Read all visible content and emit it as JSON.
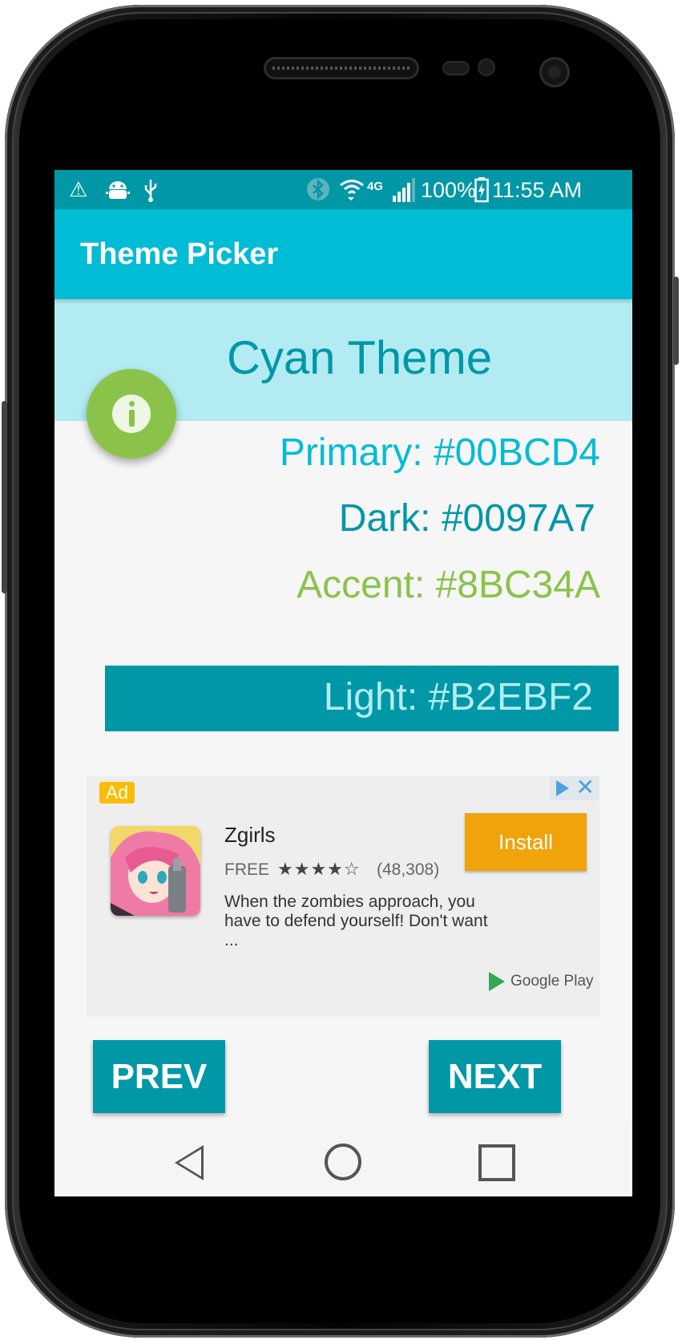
{
  "status_bar": {
    "icons": [
      "warning-icon",
      "android-debug-icon",
      "usb-icon",
      "bluetooth-icon",
      "wifi-icon",
      "signal-icon",
      "battery-charging-icon"
    ],
    "network": "4G",
    "battery": "100%",
    "time": "11:55 AM"
  },
  "app_bar": {
    "title": "Theme Picker"
  },
  "theme": {
    "title": "Cyan Theme",
    "primary": "Primary: #00BCD4",
    "dark": "Dark: #0097A7",
    "accent": "Accent: #8BC34A",
    "light": "Light: #B2EBF2",
    "colors": {
      "primary": "#00BCD4",
      "dark": "#0097A7",
      "accent": "#8BC34A",
      "light": "#B2EBF2"
    }
  },
  "fab": {
    "icon": "info-icon"
  },
  "ad": {
    "badge": "Ad",
    "app_name": "Zgirls",
    "price": "FREE",
    "stars": "★★★★☆",
    "rating": 4,
    "rating_count": "(48,308)",
    "description": "When the zombies approach, you have to defend yourself! Don't want ...",
    "install_label": "Install",
    "store_label": "Google Play"
  },
  "buttons": {
    "prev": "PREV",
    "next": "NEXT"
  },
  "nav_bar": {
    "icons": [
      "back-icon",
      "home-icon",
      "recents-icon"
    ]
  }
}
